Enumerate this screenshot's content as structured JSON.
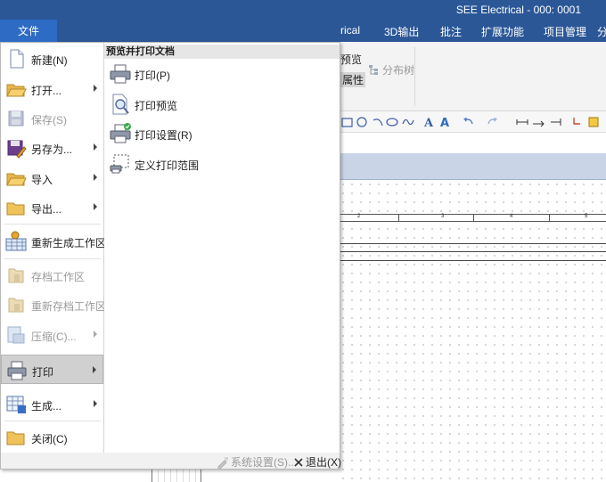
{
  "window": {
    "title": "SEE Electrical - 000: 0001"
  },
  "file_button": {
    "label": "文件"
  },
  "ribbon_tabs": [
    "rical",
    "3D输出",
    "批注",
    "扩展功能",
    "项目管理"
  ],
  "ribbon": {
    "preview_label": "预览",
    "properties_label": "属性",
    "distribution_tree_label": "分布树"
  },
  "ruler_numbers": [
    "2",
    "3",
    "4",
    "5"
  ],
  "app_menu": {
    "items": [
      {
        "label": "新建(N)",
        "icon": "new-doc-icon",
        "enabled": true,
        "submenu": false
      },
      {
        "label": "打开...",
        "icon": "open-folder-icon",
        "enabled": true,
        "submenu": true
      },
      {
        "label": "保存(S)",
        "icon": "save-icon",
        "enabled": false,
        "submenu": false
      },
      {
        "label": "另存为...",
        "icon": "save-as-icon",
        "enabled": true,
        "submenu": true
      },
      {
        "label": "导入",
        "icon": "import-icon",
        "enabled": true,
        "submenu": true
      },
      {
        "label": "导出...",
        "icon": "export-icon",
        "enabled": true,
        "submenu": true
      },
      {
        "label": "重新生成工作区",
        "icon": "regenerate-workspace-icon",
        "enabled": true,
        "submenu": false
      },
      {
        "label": "存档工作区",
        "icon": "archive-workspace-icon",
        "enabled": false,
        "submenu": false
      },
      {
        "label": "重新存档工作区",
        "icon": "rearchive-workspace-icon",
        "enabled": false,
        "submenu": false
      },
      {
        "label": "压缩(C)...",
        "icon": "compress-icon",
        "enabled": false,
        "submenu": true
      },
      {
        "label": "打印",
        "icon": "printer-icon",
        "enabled": true,
        "submenu": true,
        "active": true
      },
      {
        "label": "生成...",
        "icon": "generate-icon",
        "enabled": true,
        "submenu": true
      },
      {
        "label": "关闭(C)",
        "icon": "close-folder-icon",
        "enabled": true,
        "submenu": false
      }
    ],
    "submenu_title": "预览并打印文档",
    "submenu_items": [
      {
        "label": "打印(P)",
        "icon": "printer-icon"
      },
      {
        "label": "打印预览",
        "icon": "print-preview-icon"
      },
      {
        "label": "打印设置(R)",
        "icon": "print-setup-icon"
      },
      {
        "label": "定义打印范围",
        "icon": "define-print-range-icon"
      }
    ],
    "footer": {
      "system_settings_label": "系统设置(S)...",
      "exit_label": "退出(X)"
    }
  }
}
